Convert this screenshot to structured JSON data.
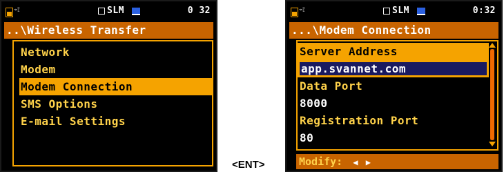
{
  "left_screen": {
    "status": {
      "icons": "⌁⟟",
      "mode": "SLM",
      "time": "0 32"
    },
    "title": "..\\Wireless Transfer",
    "menu_items": [
      {
        "label": "Network",
        "selected": false
      },
      {
        "label": "Modem",
        "selected": false
      },
      {
        "label": "Modem Connection",
        "selected": true
      },
      {
        "label": "SMS Options",
        "selected": false
      },
      {
        "label": "E-mail Settings",
        "selected": false
      }
    ]
  },
  "key_label": "<ENT>",
  "right_screen": {
    "status": {
      "icons": "⌁⟟",
      "mode": "SLM",
      "time": "0:32"
    },
    "title": "...\\Modem Connection",
    "params": [
      {
        "label": "Server Address",
        "value": "app.svannet.com"
      },
      {
        "label": "Data Port",
        "value": "8000"
      },
      {
        "label": "Registration Port",
        "value": "80"
      }
    ],
    "hint": "Modify:",
    "hint_arrows": "◀ ▶"
  },
  "colors": {
    "title_bar": "#c86400",
    "highlight": "#f5a300",
    "menu_text": "#ffd24a",
    "selected_value_bg": "#1a1a60"
  }
}
